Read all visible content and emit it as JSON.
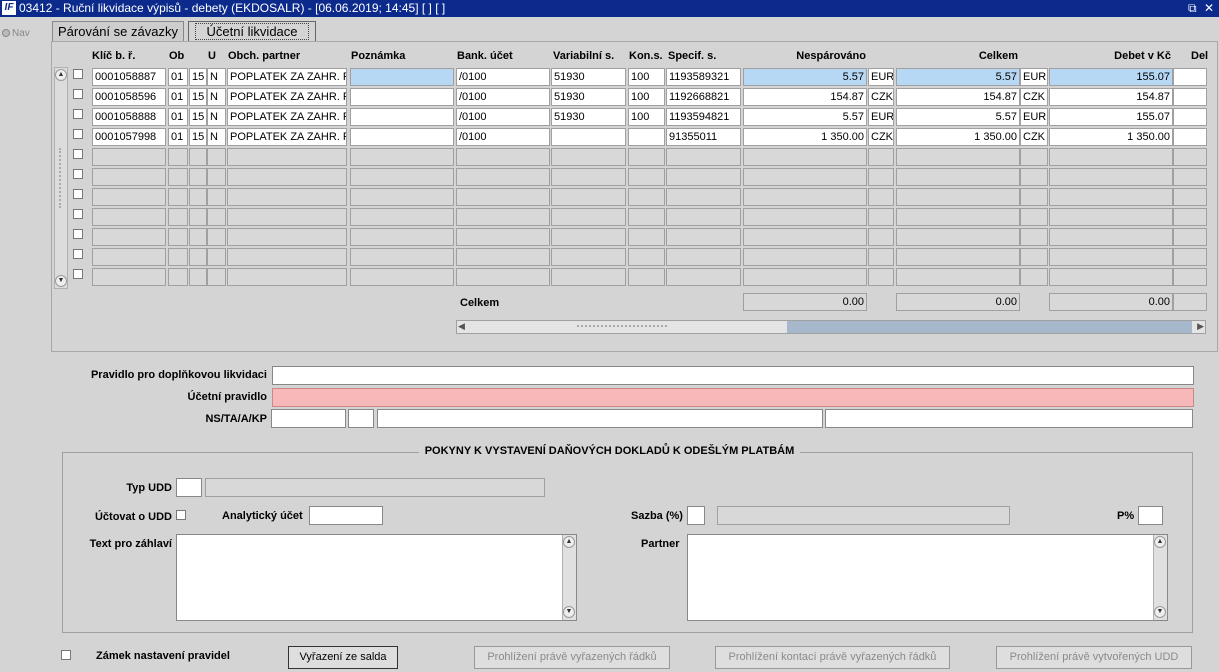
{
  "window": {
    "title": "03412 - Ruční likvidace výpisů - debety (EKDOSALR) - [06.06.2019; 14:45]  [ ]  [ ]",
    "logo": "IF",
    "restore_icon": "⧉",
    "close_icon": "✕"
  },
  "nav": {
    "label": "Nav"
  },
  "tabs": [
    {
      "label": "Párování se závazky",
      "active": false
    },
    {
      "label": "Účetní likvidace",
      "active": true
    }
  ],
  "grid": {
    "headers": {
      "key": "Klíč b. ř.",
      "ob": "Ob",
      "u": "U",
      "partner": "Obch. partner",
      "note": "Poznámka",
      "bank": "Bank. účet",
      "var": "Variabilní s.",
      "kons": "Kon.s.",
      "spec": "Specif. s.",
      "nesp": "Nespárováno",
      "celk": "Celkem",
      "debet": "Debet v Kč",
      "del": "Del"
    },
    "rows": [
      {
        "key": "0001058887",
        "ob": "01",
        "n": "15",
        "u": "N",
        "partner": "POPLATEK ZA ZAHR. PL",
        "note": "",
        "bank": "/0100",
        "var": "51930",
        "kons": "100",
        "spec": "1193589321",
        "nesp": "5.57",
        "nesp_cur": "EUR",
        "celk": "5.57",
        "celk_cur": "EUR",
        "debet": "155.07"
      },
      {
        "key": "0001058596",
        "ob": "01",
        "n": "15",
        "u": "N",
        "partner": "POPLATEK ZA ZAHR. PL",
        "note": "",
        "bank": "/0100",
        "var": "51930",
        "kons": "100",
        "spec": "1192668821",
        "nesp": "154.87",
        "nesp_cur": "CZK",
        "celk": "154.87",
        "celk_cur": "CZK",
        "debet": "154.87"
      },
      {
        "key": "0001058888",
        "ob": "01",
        "n": "15",
        "u": "N",
        "partner": "POPLATEK ZA ZAHR. PL",
        "note": "",
        "bank": "/0100",
        "var": "51930",
        "kons": "100",
        "spec": "1193594821",
        "nesp": "5.57",
        "nesp_cur": "EUR",
        "celk": "5.57",
        "celk_cur": "EUR",
        "debet": "155.07"
      },
      {
        "key": "0001057998",
        "ob": "01",
        "n": "15",
        "u": "N",
        "partner": "POPLATEK ZA ZAHR. PL",
        "note": "",
        "bank": "/0100",
        "var": "",
        "kons": "",
        "spec": "91355011",
        "nesp": "1 350.00",
        "nesp_cur": "CZK",
        "celk": "1 350.00",
        "celk_cur": "CZK",
        "debet": "1 350.00"
      }
    ],
    "empty_rows": 7,
    "totals": {
      "label": "Celkem",
      "nesp": "0.00",
      "celk": "0.00",
      "debet": "0.00"
    }
  },
  "form": {
    "pravidlo_label": "Pravidlo pro doplňkovou likvidaci",
    "ucetni_label": "Účetní pravidlo",
    "ns_label": "NS/TA/A/KP"
  },
  "pokyny": {
    "title": "POKYNY K VYSTAVENÍ DAŇOVÝCH DOKLADŮ K ODEŠLÝM PLATBÁM",
    "typ_udd": "Typ UDD",
    "uctovat": "Účtovat o UDD",
    "analyticky": "Analytický účet",
    "sazba": "Sazba (%)",
    "p_pct": "P%",
    "text_zahlavi": "Text pro záhlaví",
    "partner": "Partner"
  },
  "footer": {
    "zamek": "Zámek nastavení pravidel",
    "btn_vyrazeni": "Vyřazení ze salda",
    "btn_prohl1": "Prohlížení právě vyřazených řádků",
    "btn_prohl2": "Prohlížení kontací právě vyřazených řádků",
    "btn_prohl3": "Prohlížení právě vytvořených UDD"
  },
  "colors": {
    "title_bg": "#0b2a8c",
    "selected_row": "#b7d8f5",
    "required_field": "#f6b8b8"
  }
}
